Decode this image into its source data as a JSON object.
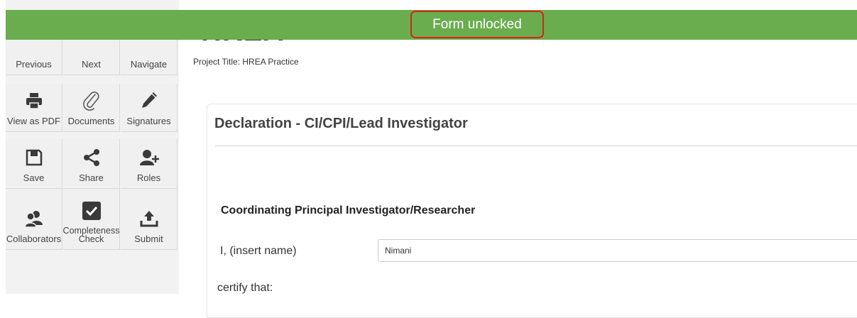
{
  "banner": {
    "message": "Form unlocked"
  },
  "header": {
    "title": "HREA",
    "project_title": "Project Title: HREA Practice"
  },
  "sidebar": {
    "tiles": [
      {
        "label": "Previous",
        "icon": "previous-icon"
      },
      {
        "label": "Next",
        "icon": "next-icon"
      },
      {
        "label": "Navigate",
        "icon": "navigate-icon"
      },
      {
        "label": "View as PDF",
        "icon": "printer-icon"
      },
      {
        "label": "Documents",
        "icon": "paperclip-icon"
      },
      {
        "label": "Signatures",
        "icon": "pencil-icon"
      },
      {
        "label": "Save",
        "icon": "save-icon"
      },
      {
        "label": "Share",
        "icon": "share-icon"
      },
      {
        "label": "Roles",
        "icon": "add-user-icon"
      },
      {
        "label": "Collaborators",
        "icon": "collaborators-icon"
      },
      {
        "label": "Completeness Check",
        "icon": "checkbox-icon"
      },
      {
        "label": "Submit",
        "icon": "upload-icon"
      }
    ]
  },
  "form": {
    "card_title": "Declaration - CI/CPI/Lead Investigator",
    "section_title": "Coordinating Principal Investigator/Researcher",
    "name_label": "I, (insert name)",
    "name_value": "Nimani",
    "certify_text": "certify that:"
  },
  "colors": {
    "banner": "#6aad4f",
    "highlight_border": "#e0201b",
    "sidebar_bg": "#f0f0f0",
    "icon": "#3a3a3a"
  }
}
